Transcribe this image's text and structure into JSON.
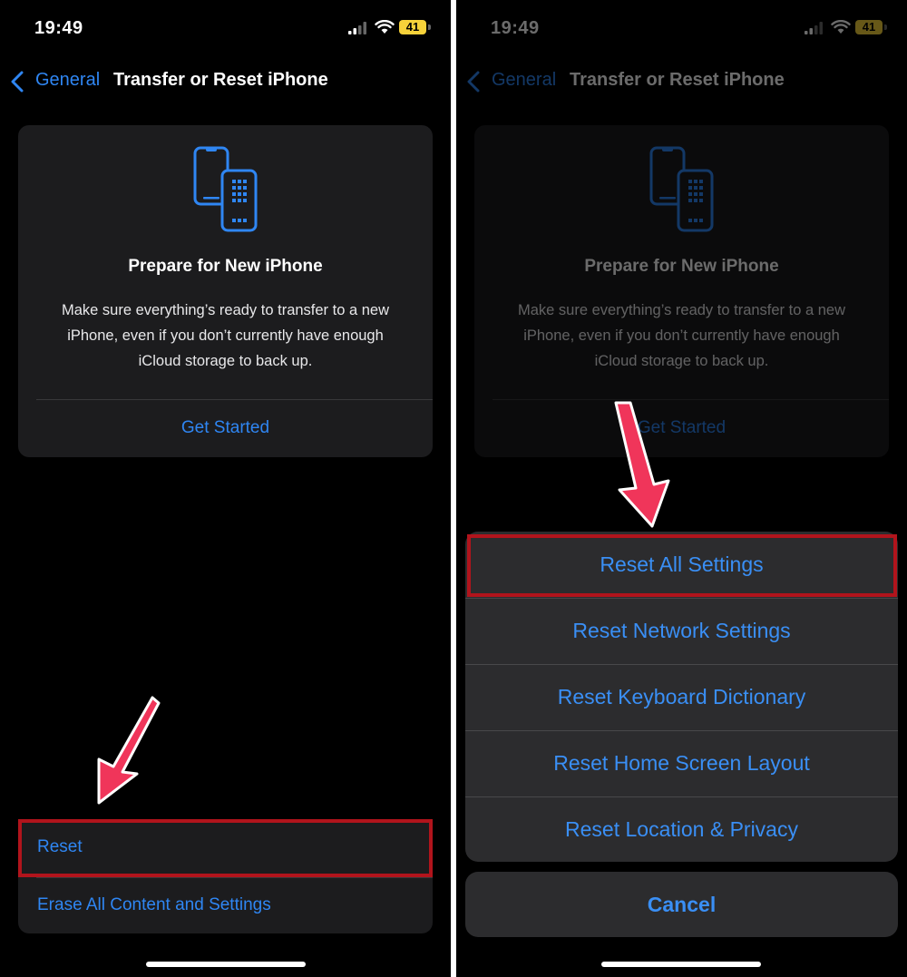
{
  "status_bar": {
    "time": "19:49",
    "battery": "41"
  },
  "nav": {
    "back_label": "General",
    "title": "Transfer or Reset iPhone"
  },
  "prepare_card": {
    "title": "Prepare for New iPhone",
    "description": "Make sure everything’s ready to transfer to a new iPhone, even if you don’t currently have enough iCloud storage to back up.",
    "cta": "Get Started"
  },
  "reset_group": {
    "items": [
      "Reset",
      "Erase All Content and Settings"
    ]
  },
  "action_sheet": {
    "items": [
      "Reset All Settings",
      "Reset Network Settings",
      "Reset Keyboard Dictionary",
      "Reset Home Screen Layout",
      "Reset Location & Privacy"
    ],
    "cancel": "Cancel"
  },
  "colors": {
    "accent": "#2f86f3",
    "highlight": "#b1141c",
    "arrow": "#f0355a",
    "background": "#000000",
    "card": "#1c1c1e"
  }
}
